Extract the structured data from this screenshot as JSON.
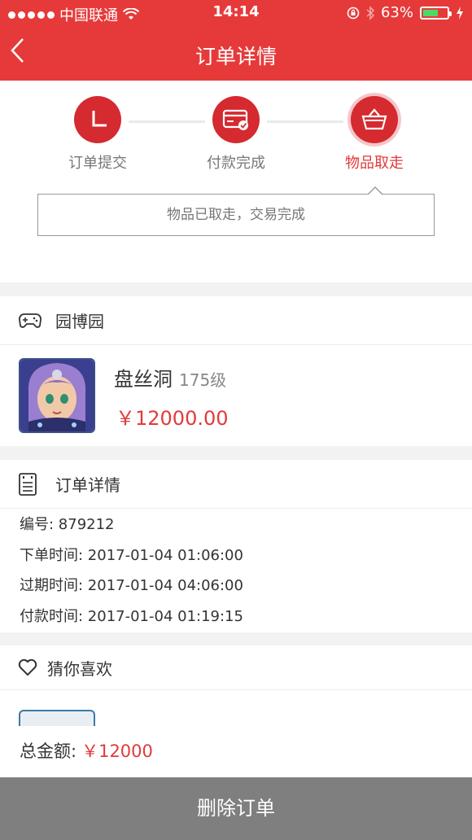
{
  "status_bar": {
    "carrier": "中国联通",
    "time": "14:14",
    "battery": "63%",
    "battery_level": 0.63
  },
  "nav": {
    "title": "订单详情",
    "back_icon": "chevron-left-icon"
  },
  "progress": {
    "steps": [
      {
        "label": "订单提交",
        "icon": "clock-icon"
      },
      {
        "label": "付款完成",
        "icon": "card-check-icon"
      },
      {
        "label": "物品取走",
        "icon": "basket-icon",
        "active": true
      }
    ],
    "message": "物品已取走，交易完成"
  },
  "shop": {
    "name": "园博园",
    "icon": "gamepad-icon",
    "product": {
      "name": "盘丝洞",
      "level": "175级",
      "price": "￥12000.00"
    }
  },
  "order_details": {
    "title": "订单详情",
    "icon": "document-icon",
    "lines": [
      "编号: 879212",
      "下单时间: 2017-01-04 01:06:00",
      "过期时间: 2017-01-04 04:06:00",
      "付款时间: 2017-01-04 01:19:15"
    ]
  },
  "recommend": {
    "title": "猜你喜欢",
    "icon": "heart-icon"
  },
  "footer": {
    "total_label": "总金额:",
    "total_value": "￥12000",
    "delete_label": "删除订单"
  },
  "colors": {
    "accent": "#e63a3a",
    "step_circle": "#d42a30",
    "delete_button": "#7f7f7f"
  }
}
